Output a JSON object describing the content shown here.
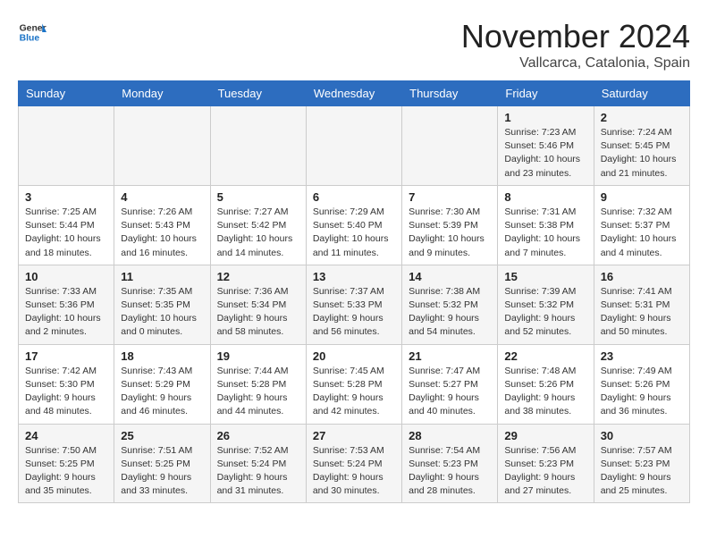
{
  "logo": {
    "text_general": "General",
    "text_blue": "Blue"
  },
  "title": "November 2024",
  "location": "Vallcarca, Catalonia, Spain",
  "headers": [
    "Sunday",
    "Monday",
    "Tuesday",
    "Wednesday",
    "Thursday",
    "Friday",
    "Saturday"
  ],
  "weeks": [
    [
      {
        "day": "",
        "info": ""
      },
      {
        "day": "",
        "info": ""
      },
      {
        "day": "",
        "info": ""
      },
      {
        "day": "",
        "info": ""
      },
      {
        "day": "",
        "info": ""
      },
      {
        "day": "1",
        "info": "Sunrise: 7:23 AM\nSunset: 5:46 PM\nDaylight: 10 hours\nand 23 minutes."
      },
      {
        "day": "2",
        "info": "Sunrise: 7:24 AM\nSunset: 5:45 PM\nDaylight: 10 hours\nand 21 minutes."
      }
    ],
    [
      {
        "day": "3",
        "info": "Sunrise: 7:25 AM\nSunset: 5:44 PM\nDaylight: 10 hours\nand 18 minutes."
      },
      {
        "day": "4",
        "info": "Sunrise: 7:26 AM\nSunset: 5:43 PM\nDaylight: 10 hours\nand 16 minutes."
      },
      {
        "day": "5",
        "info": "Sunrise: 7:27 AM\nSunset: 5:42 PM\nDaylight: 10 hours\nand 14 minutes."
      },
      {
        "day": "6",
        "info": "Sunrise: 7:29 AM\nSunset: 5:40 PM\nDaylight: 10 hours\nand 11 minutes."
      },
      {
        "day": "7",
        "info": "Sunrise: 7:30 AM\nSunset: 5:39 PM\nDaylight: 10 hours\nand 9 minutes."
      },
      {
        "day": "8",
        "info": "Sunrise: 7:31 AM\nSunset: 5:38 PM\nDaylight: 10 hours\nand 7 minutes."
      },
      {
        "day": "9",
        "info": "Sunrise: 7:32 AM\nSunset: 5:37 PM\nDaylight: 10 hours\nand 4 minutes."
      }
    ],
    [
      {
        "day": "10",
        "info": "Sunrise: 7:33 AM\nSunset: 5:36 PM\nDaylight: 10 hours\nand 2 minutes."
      },
      {
        "day": "11",
        "info": "Sunrise: 7:35 AM\nSunset: 5:35 PM\nDaylight: 10 hours\nand 0 minutes."
      },
      {
        "day": "12",
        "info": "Sunrise: 7:36 AM\nSunset: 5:34 PM\nDaylight: 9 hours\nand 58 minutes."
      },
      {
        "day": "13",
        "info": "Sunrise: 7:37 AM\nSunset: 5:33 PM\nDaylight: 9 hours\nand 56 minutes."
      },
      {
        "day": "14",
        "info": "Sunrise: 7:38 AM\nSunset: 5:32 PM\nDaylight: 9 hours\nand 54 minutes."
      },
      {
        "day": "15",
        "info": "Sunrise: 7:39 AM\nSunset: 5:32 PM\nDaylight: 9 hours\nand 52 minutes."
      },
      {
        "day": "16",
        "info": "Sunrise: 7:41 AM\nSunset: 5:31 PM\nDaylight: 9 hours\nand 50 minutes."
      }
    ],
    [
      {
        "day": "17",
        "info": "Sunrise: 7:42 AM\nSunset: 5:30 PM\nDaylight: 9 hours\nand 48 minutes."
      },
      {
        "day": "18",
        "info": "Sunrise: 7:43 AM\nSunset: 5:29 PM\nDaylight: 9 hours\nand 46 minutes."
      },
      {
        "day": "19",
        "info": "Sunrise: 7:44 AM\nSunset: 5:28 PM\nDaylight: 9 hours\nand 44 minutes."
      },
      {
        "day": "20",
        "info": "Sunrise: 7:45 AM\nSunset: 5:28 PM\nDaylight: 9 hours\nand 42 minutes."
      },
      {
        "day": "21",
        "info": "Sunrise: 7:47 AM\nSunset: 5:27 PM\nDaylight: 9 hours\nand 40 minutes."
      },
      {
        "day": "22",
        "info": "Sunrise: 7:48 AM\nSunset: 5:26 PM\nDaylight: 9 hours\nand 38 minutes."
      },
      {
        "day": "23",
        "info": "Sunrise: 7:49 AM\nSunset: 5:26 PM\nDaylight: 9 hours\nand 36 minutes."
      }
    ],
    [
      {
        "day": "24",
        "info": "Sunrise: 7:50 AM\nSunset: 5:25 PM\nDaylight: 9 hours\nand 35 minutes."
      },
      {
        "day": "25",
        "info": "Sunrise: 7:51 AM\nSunset: 5:25 PM\nDaylight: 9 hours\nand 33 minutes."
      },
      {
        "day": "26",
        "info": "Sunrise: 7:52 AM\nSunset: 5:24 PM\nDaylight: 9 hours\nand 31 minutes."
      },
      {
        "day": "27",
        "info": "Sunrise: 7:53 AM\nSunset: 5:24 PM\nDaylight: 9 hours\nand 30 minutes."
      },
      {
        "day": "28",
        "info": "Sunrise: 7:54 AM\nSunset: 5:23 PM\nDaylight: 9 hours\nand 28 minutes."
      },
      {
        "day": "29",
        "info": "Sunrise: 7:56 AM\nSunset: 5:23 PM\nDaylight: 9 hours\nand 27 minutes."
      },
      {
        "day": "30",
        "info": "Sunrise: 7:57 AM\nSunset: 5:23 PM\nDaylight: 9 hours\nand 25 minutes."
      }
    ]
  ]
}
